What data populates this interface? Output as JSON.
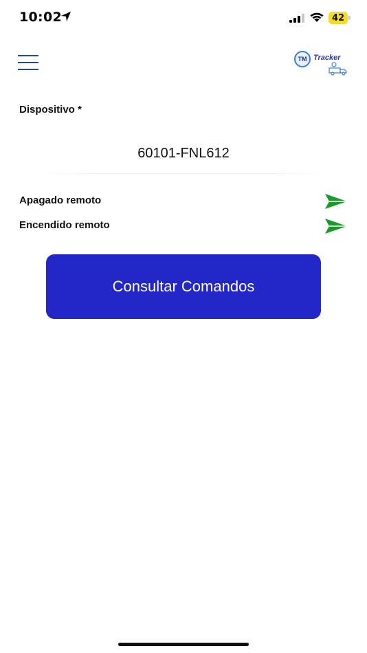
{
  "status_bar": {
    "time": "10:02",
    "battery_level": "42",
    "battery_color": "#f5dc2a",
    "icons": [
      "location-arrow-icon",
      "signal-icon",
      "wifi-icon",
      "battery-icon"
    ]
  },
  "header": {
    "menu_icon": "hamburger-menu-icon",
    "logo_text": "Tracker",
    "logo_badge": "TM"
  },
  "form": {
    "device_label": "Dispositivo *",
    "device_value": "60101-FNL612"
  },
  "commands": [
    {
      "label": "Apagado remoto",
      "action_icon": "send-icon"
    },
    {
      "label": "Encendido remoto",
      "action_icon": "send-icon"
    }
  ],
  "consult_button": {
    "label": "Consultar Comandos"
  },
  "colors": {
    "primary_button": "#2427c8",
    "send_icon": "#1a9a2a",
    "menu_icon": "#1f4f8c"
  }
}
